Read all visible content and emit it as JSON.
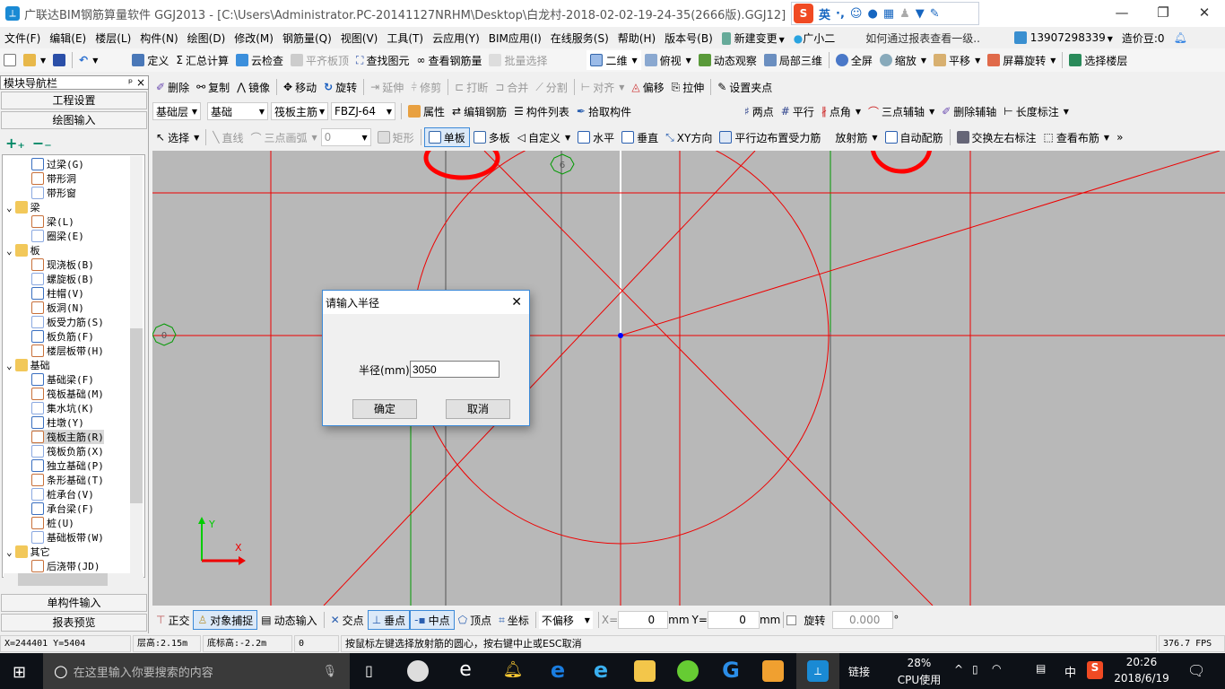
{
  "window": {
    "title": "广联达BIM钢筋算量软件 GGJ2013 - [C:\\Users\\Administrator.PC-20141127NRHM\\Desktop\\白龙村-2018-02-02-19-24-35(2666版).GGJ12]",
    "minimize": "—",
    "restore": "❐",
    "close": "✕"
  },
  "ime": {
    "lang": "英",
    "punct": "·,"
  },
  "menu": [
    "文件(F)",
    "编辑(E)",
    "楼层(L)",
    "构件(N)",
    "绘图(D)",
    "修改(M)",
    "钢筋量(Q)",
    "视图(V)",
    "工具(T)",
    "云应用(Y)",
    "BIM应用(I)",
    "在线服务(S)",
    "帮助(H)",
    "版本号(B)",
    "新建变更",
    "广小二"
  ],
  "menu_tip": "如何通过报表查看一级..",
  "account": {
    "phone": "13907298339",
    "beans": "造价豆:0"
  },
  "toolbar1": [
    "定义",
    "汇总计算",
    "云检查",
    "平齐板顶",
    "查找图元",
    "查看钢筋量",
    "批量选择"
  ],
  "toolbar1r": [
    "二维",
    "俯视",
    "动态观察",
    "局部三维",
    "全屏",
    "缩放",
    "平移",
    "屏幕旋转",
    "选择楼层"
  ],
  "toolbar2": [
    "删除",
    "复制",
    "镜像",
    "移动",
    "旋转",
    "延伸",
    "修剪",
    "打断",
    "合并",
    "分割",
    "对齐",
    "偏移",
    "拉伸",
    "设置夹点"
  ],
  "selectors": {
    "floor": "基础层",
    "category": "基础",
    "type": "筏板主筋",
    "name": "FBZJ-64"
  },
  "toolbar3": [
    "属性",
    "编辑钢筋",
    "构件列表",
    "拾取构件"
  ],
  "axis_tools": [
    "两点",
    "平行",
    "点角",
    "三点辅轴",
    "删除辅轴",
    "长度标注"
  ],
  "draw_tools": {
    "select": "选择",
    "line": "直线",
    "arc": "三点画弧",
    "arc_value": "0",
    "rect": "矩形",
    "single": "单板",
    "multi": "多板",
    "custom": "自定义",
    "horizontal": "水平",
    "vertical": "垂直",
    "xy": "XY方向",
    "parallel": "平行边布置受力筋",
    "radial": "放射筋",
    "auto": "自动配筋",
    "swap": "交换左右标注",
    "view": "查看布筋"
  },
  "nav": {
    "title": "模块导航栏",
    "pin": "ᵖ",
    "close": "×",
    "project": "工程设置",
    "draw": "绘图输入",
    "single": "单构件输入",
    "report": "报表预览"
  },
  "tree": [
    {
      "label": "过梁(G)",
      "level": 2
    },
    {
      "label": "带形洞",
      "level": 2
    },
    {
      "label": "带形窗",
      "level": 2
    },
    {
      "label": "梁",
      "level": 1
    },
    {
      "label": "梁(L)",
      "level": 2
    },
    {
      "label": "圈梁(E)",
      "level": 2
    },
    {
      "label": "板",
      "level": 1
    },
    {
      "label": "现浇板(B)",
      "level": 2
    },
    {
      "label": "螺旋板(B)",
      "level": 2
    },
    {
      "label": "柱帽(V)",
      "level": 2
    },
    {
      "label": "板洞(N)",
      "level": 2
    },
    {
      "label": "板受力筋(S)",
      "level": 2
    },
    {
      "label": "板负筋(F)",
      "level": 2
    },
    {
      "label": "楼层板带(H)",
      "level": 2
    },
    {
      "label": "基础",
      "level": 1
    },
    {
      "label": "基础梁(F)",
      "level": 2
    },
    {
      "label": "筏板基础(M)",
      "level": 2
    },
    {
      "label": "集水坑(K)",
      "level": 2
    },
    {
      "label": "柱墩(Y)",
      "level": 2
    },
    {
      "label": "筏板主筋(R)",
      "level": 2,
      "selected": true
    },
    {
      "label": "筏板负筋(X)",
      "level": 2
    },
    {
      "label": "独立基础(P)",
      "level": 2
    },
    {
      "label": "条形基础(T)",
      "level": 2
    },
    {
      "label": "桩承台(V)",
      "level": 2
    },
    {
      "label": "承台梁(F)",
      "level": 2
    },
    {
      "label": "桩(U)",
      "level": 2
    },
    {
      "label": "基础板带(W)",
      "level": 2
    },
    {
      "label": "其它",
      "level": 1
    },
    {
      "label": "后浇带(JD)",
      "level": 2
    }
  ],
  "canvas": {
    "axis_labels": {
      "y": "Y",
      "x": "X"
    },
    "grid_markers": [
      "6",
      "0"
    ],
    "colors": {
      "bg": "#b8b8b8",
      "line": "#ff0000",
      "aux": "#00a000"
    }
  },
  "dialog": {
    "title": "请输入半径",
    "label": "半径(mm):",
    "value": "3050",
    "ok": "确定",
    "cancel": "取消",
    "close": "✕"
  },
  "snap": {
    "ortho": "正交",
    "snap": "对象捕捉",
    "dynamic": "动态输入",
    "intersect": "交点",
    "perp": "垂点",
    "mid": "中点",
    "vertex": "顶点",
    "coord": "坐标",
    "offset": "不偏移",
    "x_label": "X=",
    "x": "0",
    "mm1": "mm",
    "y_label": "Y=",
    "y": "0",
    "mm2": "mm",
    "rotate": "旋转",
    "angle": "0.000",
    "deg": "°"
  },
  "status": {
    "coords": "X=244401 Y=5404",
    "floor_h": "层高:2.15m",
    "bottom": "底标高:-2.2m",
    "count": "0",
    "hint": "按鼠标左键选择放射筋的圆心，按右键中止或ESC取消",
    "fps": "376.7 FPS"
  },
  "taskbar": {
    "search": "在这里输入你要搜索的内容",
    "link": "链接",
    "cpu": "28%",
    "cpu_label": "CPU使用",
    "ime": "中",
    "time": "20:26",
    "date": "2018/6/19"
  }
}
